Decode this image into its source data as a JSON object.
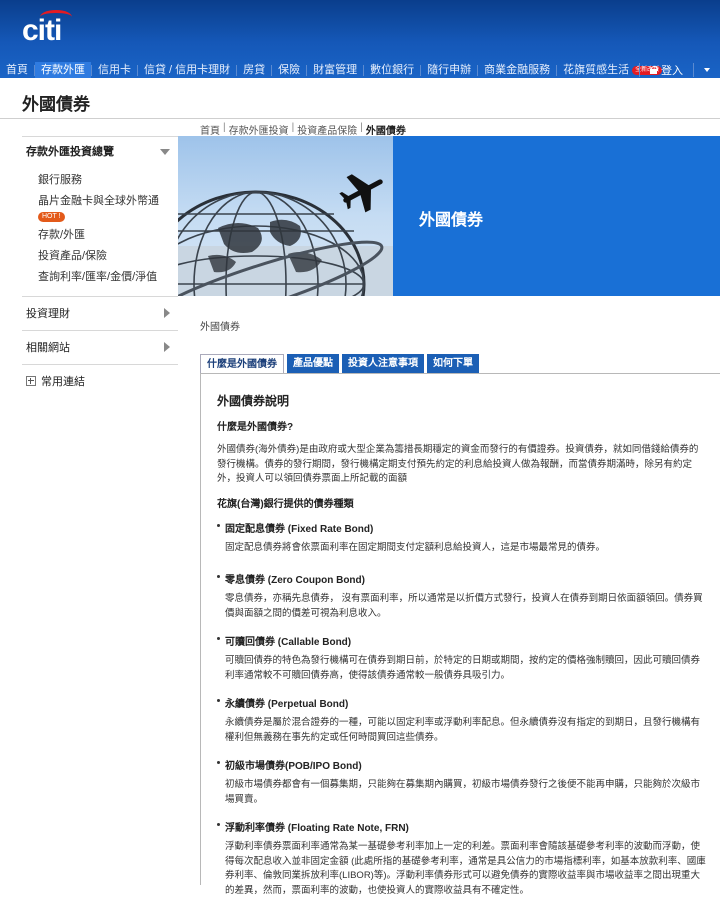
{
  "brand": {
    "logo_text": "citi",
    "accent": "#e31b23",
    "primary": "#1a64c6"
  },
  "nav": {
    "items": [
      {
        "label": "首頁",
        "active": false
      },
      {
        "label": "存款外匯",
        "active": true
      },
      {
        "label": "信用卡",
        "active": false
      },
      {
        "label": "信貸 / 信用卡理財",
        "active": false
      },
      {
        "label": "房貸",
        "active": false
      },
      {
        "label": "保險",
        "active": false
      },
      {
        "label": "財富管理",
        "active": false
      },
      {
        "label": "數位銀行",
        "active": false
      },
      {
        "label": "隨行申辦",
        "active": false
      },
      {
        "label": "商業金融服務",
        "active": false
      },
      {
        "label": "花旗質感生活",
        "active": false,
        "badge": "全新改版"
      }
    ],
    "login_label": "登入"
  },
  "page_title": "外國債券",
  "breadcrumb": [
    "首頁",
    "存款外匯投資",
    "投資產品保險",
    "外國債券"
  ],
  "sidebar": {
    "head": "存款外匯投資總覽",
    "sub_items": [
      "銀行服務",
      "晶片金融卡與全球外幣通",
      "存款/外匯",
      "投資產品/保險",
      "查詢利率/匯率/金價/淨值"
    ],
    "hot_badge": "HOT !",
    "sections": [
      "投資理財",
      "相關網站"
    ],
    "links_label": "常用連結"
  },
  "hero": {
    "title": "外國債券"
  },
  "section_label": "外國債券",
  "tabs": [
    "什麼是外國債券",
    "產品優點",
    "投資人注意事項",
    "如何下單"
  ],
  "content": {
    "heading": "外國債券說明",
    "q1": "什麼是外國債券?",
    "p1": "外國債券(海外債券)是由政府或大型企業為籌措長期穩定的資金而發行的有價證券。投資債券，就如同借錢給債券的發行機構。債券的發行期間，發行機構定期支付預先約定的利息給投資人做為報酬，而當債券期滿時，除另有約定外，投資人可以領回債券票面上所記載的面額",
    "q2": "花旗(台灣)銀行提供的債券種類",
    "bonds": [
      {
        "title": "固定配息債券 (Fixed Rate Bond)",
        "desc": "固定配息債券將會依票面利率在固定期間支付定額利息給投資人，這是市場最常見的債券。"
      },
      {
        "title": "零息債券 (Zero Coupon Bond)",
        "desc": "零息債券，亦稱先息債券，  沒有票面利率，所以通常是以折價方式發行，投資人在債券到期日依面額領回。債券買價與面額之間的價差可視為利息收入。"
      },
      {
        "title": "可贖回債券 (Callable Bond)",
        "desc": "可贖回債券的特色為發行機構可在債券到期日前，於特定的日期或期間，按約定的價格強制贖回，因此可贖回債券利率通常較不可贖回債券高，使得該債券通常較一般債券具吸引力。"
      },
      {
        "title": "永續債券 (Perpetual Bond)",
        "desc": "永續債券是屬於混合證券的一種，可能以固定利率或浮動利率配息。但永續債券沒有指定的到期日，且發行機構有權利但無義務在事先約定或任何時間買回這些債券。"
      },
      {
        "title": "初級市場債券(POB/IPO Bond)",
        "desc": "初級市場債券都會有一個募集期，只能夠在募集期內購買，初級市場債券發行之後便不能再申購，只能夠於次級市場買賣。"
      },
      {
        "title": "浮動利率債券 (Floating Rate Note, FRN)",
        "desc": "浮動利率債券票面利率通常為某一基礎參考利率加上一定的利差。票面利率會隨該基礎參考利率的波動而浮動，使得每次配息收入並非固定金額 (此處所指的基礎參考利率，通常是具公信力的市場指標利率，如基本放款利率、國庫券利率、倫敦同業拆放利率(LIBOR)等)。浮動利率債券形式可以避免債券的實際收益率與市場收益率之間出現重大的差異，然而，票面利率的波動，也使投資人的實際收益具有不確定性。"
      }
    ]
  }
}
